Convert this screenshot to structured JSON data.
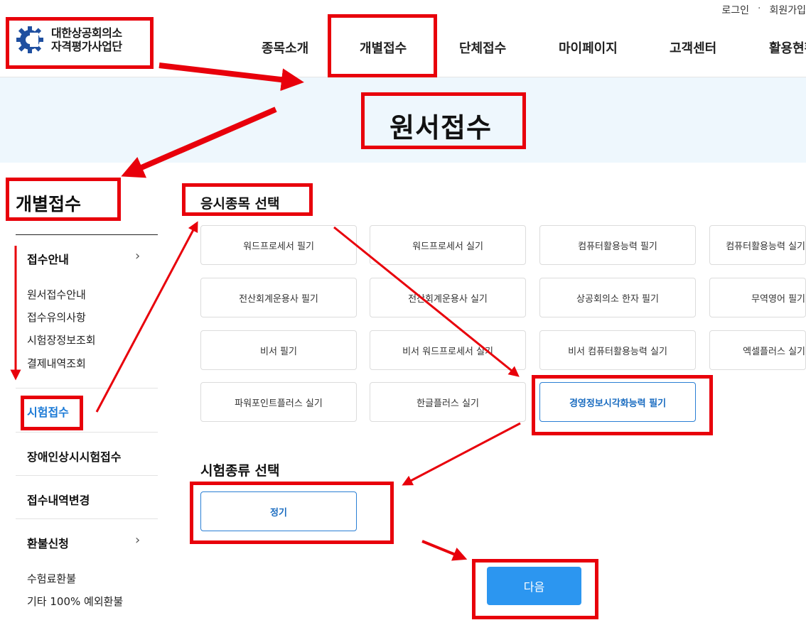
{
  "util": {
    "login": "로그인",
    "sep": "·",
    "join": "회원가입"
  },
  "logo": {
    "line1": "대한상공회의소",
    "line2": "자격평가사업단"
  },
  "nav": [
    "종목소개",
    "개별접수",
    "단체접수",
    "마이페이지",
    "고객센터",
    "활용현황"
  ],
  "banner": {
    "title": "원서접수"
  },
  "sidebar": {
    "title": "개별접수",
    "items": [
      {
        "label": "접수안내",
        "chevron": "›"
      },
      {
        "label": "원서접수안내"
      },
      {
        "label": "접수유의사항"
      },
      {
        "label": "시험장정보조회"
      },
      {
        "label": "결제내역조회"
      },
      {
        "label": "시험접수"
      },
      {
        "label": "장애인상시시험접수"
      },
      {
        "label": "접수내역변경"
      },
      {
        "label": "환불신청",
        "chevron": "›"
      },
      {
        "label": "수험료환불"
      },
      {
        "label": "기타 100% 예외환불"
      }
    ]
  },
  "section1": {
    "title": "응시종목 선택",
    "options": [
      "워드프로세서 필기",
      "워드프로세서 실기",
      "컴퓨터활용능력 필기",
      "컴퓨터활용능력 실기",
      "전산회계운용사 필기",
      "전산회계운용사 실기",
      "상공회의소 한자 필기",
      "무역영어 필기",
      "비서 필기",
      "비서 워드프로세서 실기",
      "비서 컴퓨터활용능력 실기",
      "엑셀플러스 실기",
      "파워포인트플러스 실기",
      "한글플러스 실기",
      "경영정보시각화능력 필기"
    ]
  },
  "section2": {
    "title": "시험종류 선택",
    "option": "정기"
  },
  "next": {
    "label": "다음"
  },
  "colors": {
    "annotation": "#e8000b",
    "accent": "#2c96f0",
    "banner": "#eef7fd"
  }
}
